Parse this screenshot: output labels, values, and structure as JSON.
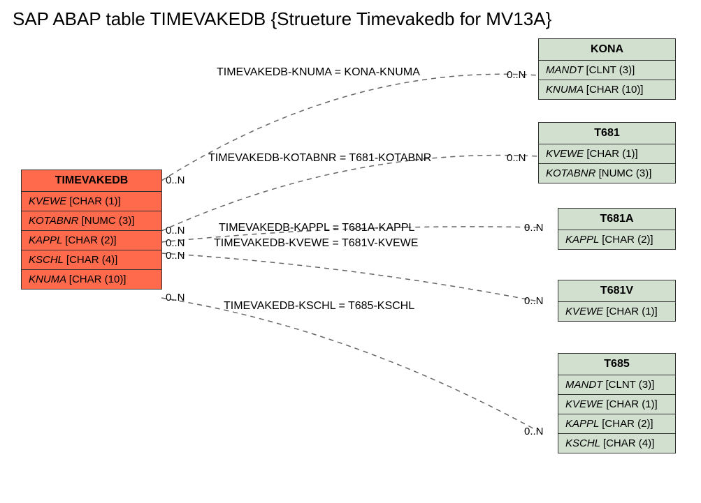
{
  "title": "SAP ABAP table TIMEVAKEDB {Strueture Timevakedb for MV13A}",
  "source": {
    "name": "TIMEVAKEDB",
    "fields": [
      {
        "name": "KVEWE",
        "type": "[CHAR (1)]"
      },
      {
        "name": "KOTABNR",
        "type": "[NUMC (3)]"
      },
      {
        "name": "KAPPL",
        "type": "[CHAR (2)]"
      },
      {
        "name": "KSCHL",
        "type": "[CHAR (4)]"
      },
      {
        "name": "KNUMA",
        "type": "[CHAR (10)]"
      }
    ]
  },
  "targets": {
    "kona": {
      "name": "KONA",
      "fields": [
        {
          "name": "MANDT",
          "type": "[CLNT (3)]"
        },
        {
          "name": "KNUMA",
          "type": "[CHAR (10)]"
        }
      ]
    },
    "t681": {
      "name": "T681",
      "fields": [
        {
          "name": "KVEWE",
          "type": "[CHAR (1)]"
        },
        {
          "name": "KOTABNR",
          "type": "[NUMC (3)]"
        }
      ]
    },
    "t681a": {
      "name": "T681A",
      "fields": [
        {
          "name": "KAPPL",
          "type": "[CHAR (2)]"
        }
      ]
    },
    "t681v": {
      "name": "T681V",
      "fields": [
        {
          "name": "KVEWE",
          "type": "[CHAR (1)]"
        }
      ]
    },
    "t685": {
      "name": "T685",
      "fields": [
        {
          "name": "MANDT",
          "type": "[CLNT (3)]"
        },
        {
          "name": "KVEWE",
          "type": "[CHAR (1)]"
        },
        {
          "name": "KAPPL",
          "type": "[CHAR (2)]"
        },
        {
          "name": "KSCHL",
          "type": "[CHAR (4)]"
        }
      ]
    }
  },
  "relations": {
    "r1": "TIMEVAKEDB-KNUMA = KONA-KNUMA",
    "r2": "TIMEVAKEDB-KOTABNR = T681-KOTABNR",
    "r3": "TIMEVAKEDB-KAPPL = T681A-KAPPL",
    "r4": "TIMEVAKEDB-KVEWE = T681V-KVEWE",
    "r5": "TIMEVAKEDB-KSCHL = T685-KSCHL"
  },
  "card": "0..N"
}
